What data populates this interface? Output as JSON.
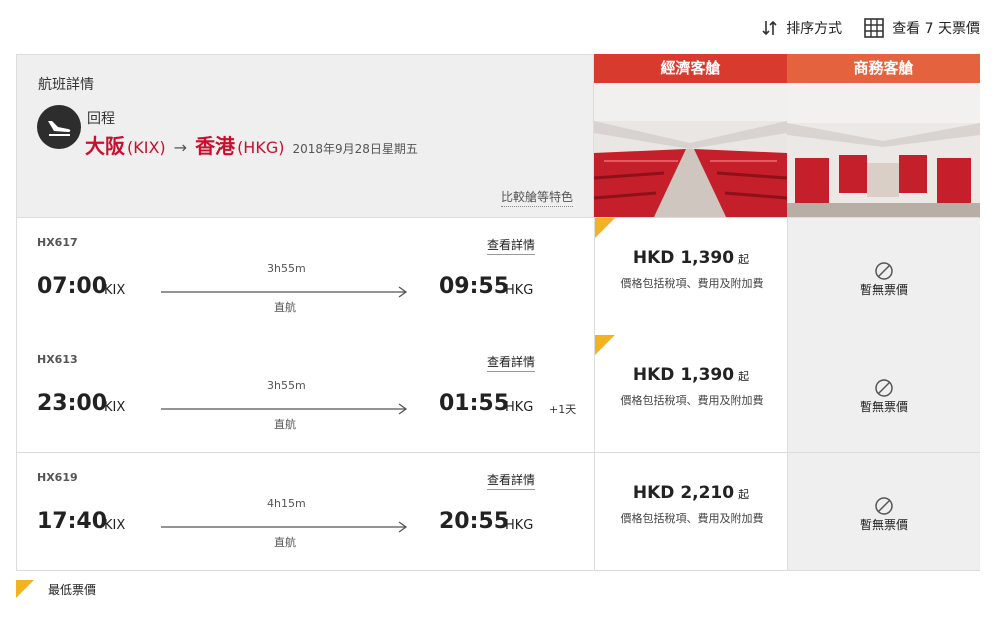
{
  "toolbar": {
    "sort_label": "排序方式",
    "view7_label": "查看 7 天票價"
  },
  "header": {
    "section_title": "航班詳情",
    "trip_label": "回程",
    "origin_city": "大阪",
    "origin_code": "(KIX)",
    "dest_city": "香港",
    "dest_code": "(HKG)",
    "date": "2018年9月28日星期五",
    "compare_link": "比較艙等特色"
  },
  "cabins": {
    "economy": "經濟客艙",
    "business": "商務客艙"
  },
  "flights": [
    {
      "flight_no": "HX617",
      "details": "查看詳情",
      "dep_time": "07:00",
      "dep_code": "KIX",
      "duration": "3h55m",
      "stops": "直航",
      "arr_time": "09:55",
      "arr_code": "HKG",
      "day_plus": "",
      "price": "HKD 1,390",
      "price_suffix": "起",
      "price_note": "價格包括稅項、費用及附加費",
      "lowest": true,
      "business_na": "暫無票價"
    },
    {
      "flight_no": "HX613",
      "details": "查看詳情",
      "dep_time": "23:00",
      "dep_code": "KIX",
      "duration": "3h55m",
      "stops": "直航",
      "arr_time": "01:55",
      "arr_code": "HKG",
      "day_plus": "+1天",
      "price": "HKD 1,390",
      "price_suffix": "起",
      "price_note": "價格包括稅項、費用及附加費",
      "lowest": true,
      "business_na": "暫無票價"
    },
    {
      "flight_no": "HX619",
      "details": "查看詳情",
      "dep_time": "17:40",
      "dep_code": "KIX",
      "duration": "4h15m",
      "stops": "直航",
      "arr_time": "20:55",
      "arr_code": "HKG",
      "day_plus": "",
      "price": "HKD 2,210",
      "price_suffix": "起",
      "price_note": "價格包括稅項、費用及附加費",
      "lowest": false,
      "business_na": "暫無票價"
    }
  ],
  "legend": {
    "lowest_label": "最低票價"
  },
  "colors": {
    "brand_red": "#c8102e",
    "economy_header": "#d93a2e",
    "business_header": "#e4623d",
    "lowest_marker": "#f0b323"
  },
  "icons": [
    "sort-icon",
    "calendar-grid-icon",
    "plane-landing-icon",
    "arrow-right-icon",
    "no-fare-icon"
  ]
}
